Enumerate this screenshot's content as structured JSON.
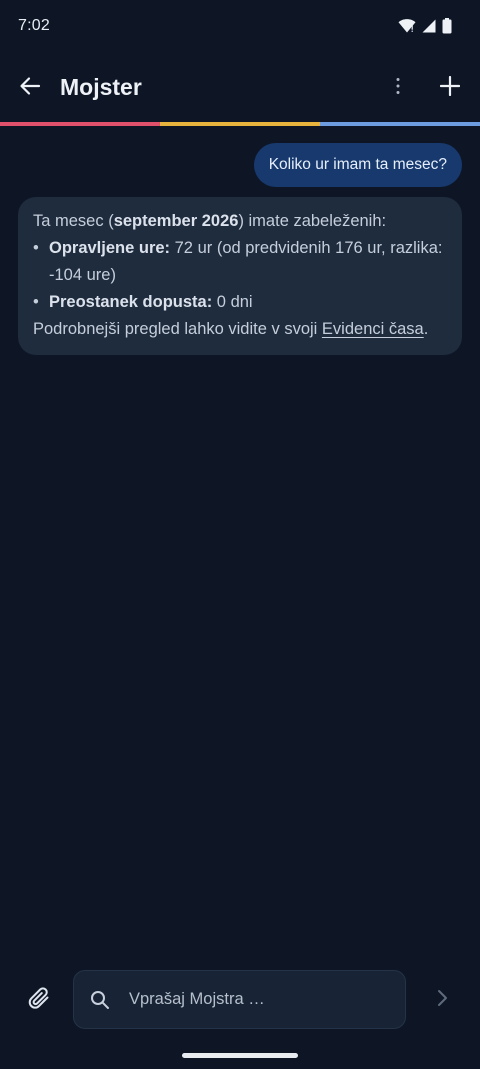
{
  "status_bar": {
    "time": "7:02",
    "icons": [
      "wifi-icon",
      "signal-icon",
      "battery-icon"
    ]
  },
  "app_bar": {
    "title": "Mojster",
    "icons": [
      "back-arrow-icon",
      "more-vert-icon",
      "plus-icon"
    ]
  },
  "brand_colors": [
    "#e0506a",
    "#e8b33c",
    "#6d9de0"
  ],
  "conversation": {
    "user_message": "Koliko ur imam ta mesec?",
    "bot_message": {
      "intro_prefix": "Ta mesec (",
      "intro_month": "september 2026",
      "intro_suffix": ") imate zabeleženih:",
      "bullets": [
        {
          "label": "Opravljene ure:",
          "value": " 72 ur (od predvidenih 176 ur, razlika: -104 ure)"
        },
        {
          "label": "Preostanek dopusta:",
          "value": " 0 dni"
        }
      ],
      "outro_prefix": "Podrobnejši pregled lahko vidite v svoji ",
      "link_text": "Evidenci časa",
      "outro_suffix": "."
    }
  },
  "input_bar": {
    "placeholder": "Vprašaj Mojstra …",
    "value": "",
    "icons": [
      "paperclip-icon",
      "search-icon",
      "send-chevron-icon"
    ]
  },
  "colors": {
    "background": "#0e1626",
    "user_bubble": "#17396e",
    "bot_bubble": "#1f2c3e",
    "input_bg": "#182436"
  }
}
